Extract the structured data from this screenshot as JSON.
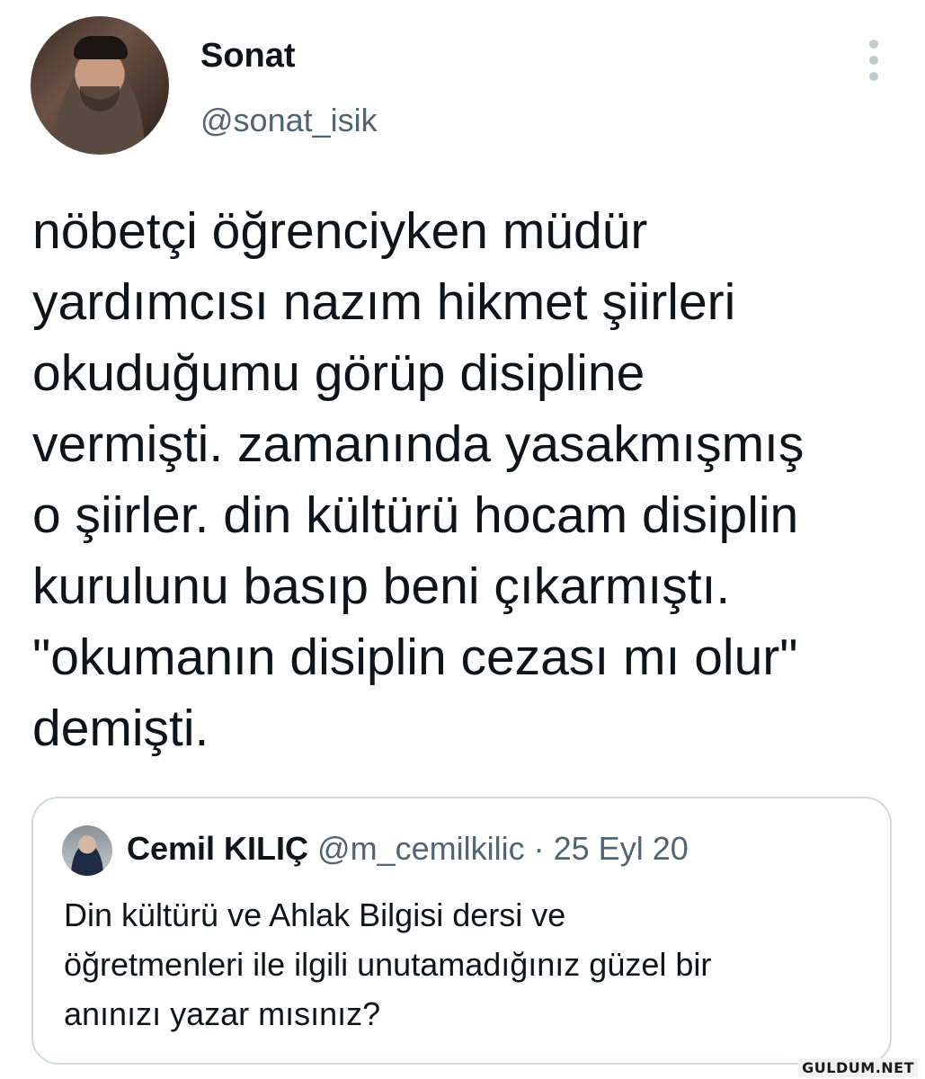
{
  "author": {
    "display_name": "Sonat",
    "handle": "@sonat_isik",
    "avatar_icon": "profile-photo"
  },
  "more_icon": "more-vertical-icon",
  "tweet": {
    "text": "nöbetçi öğrenciyken müdür\nyardımcısı nazım hikmet şiirleri\nokuduğumu görüp disipline\nvermişti. zamanında yasakmışmış\no şiirler. din kültürü hocam disiplin\nkurulunu basıp beni çıkarmıştı.\n\"okumanın disiplin cezası mı olur\"\ndemişti."
  },
  "quote": {
    "display_name": "Cemil KILIÇ",
    "handle": "@m_cemilkilic",
    "separator": "·",
    "date": "25 Eyl 20",
    "text": "Din kültürü ve Ahlak Bilgisi dersi ve\nöğretmenleri ile ilgili unutamadığınız güzel bir\nanınızı yazar mısınız?"
  },
  "watermark": "GULDUM.NET",
  "colors": {
    "primary_text": "#0f1419",
    "secondary_text": "#536471",
    "border": "#cfd9de"
  }
}
